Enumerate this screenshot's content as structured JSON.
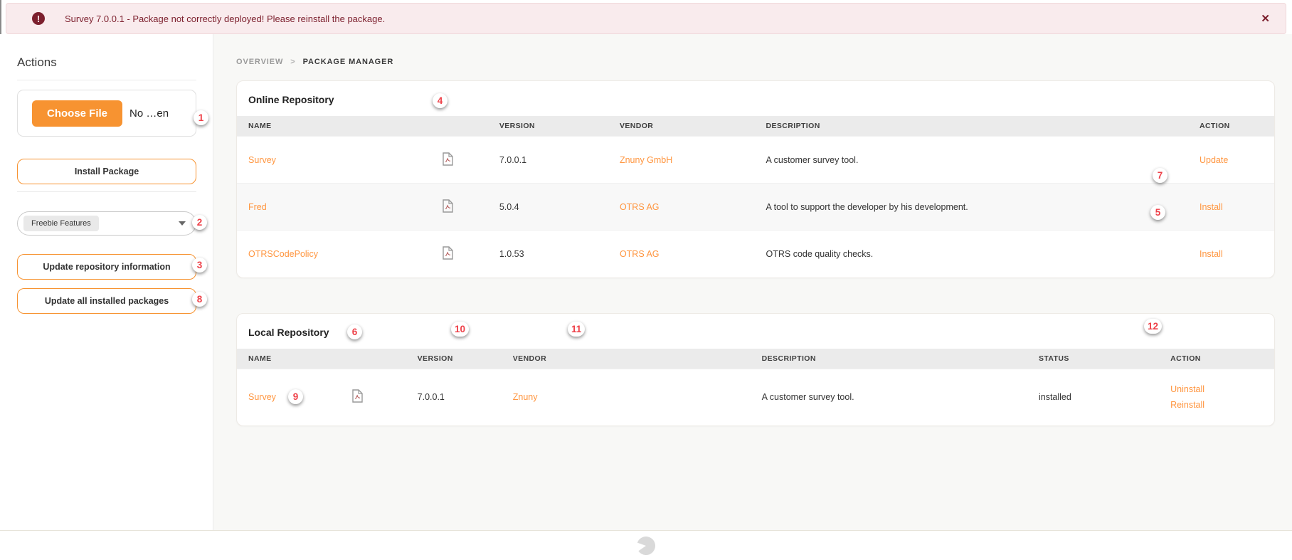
{
  "banner": {
    "icon_glyph": "!",
    "text": "Survey 7.0.0.1 - Package not correctly deployed! Please reinstall the package.",
    "close_glyph": "✕"
  },
  "sidebar": {
    "title": "Actions",
    "choose_file": "Choose File",
    "file_status": "No …en",
    "install": "Install Package",
    "select_value": "Freebie Features",
    "update_repo": "Update repository information",
    "update_all": "Update all installed packages"
  },
  "breadcrumb": {
    "overview": "OVERVIEW",
    "separator": ">",
    "current": "PACKAGE MANAGER"
  },
  "online": {
    "title": "Online Repository",
    "headers": {
      "name": "NAME",
      "version": "VERSION",
      "vendor": "VENDOR",
      "description": "DESCRIPTION",
      "action": "ACTION"
    },
    "rows": [
      {
        "name": "Survey",
        "version": "7.0.0.1",
        "vendor": "Znuny GmbH",
        "description": "A customer survey tool.",
        "action": "Update"
      },
      {
        "name": "Fred",
        "version": "5.0.4",
        "vendor": "OTRS AG",
        "description": "A tool to support the developer by his development.",
        "action": "Install"
      },
      {
        "name": "OTRSCodePolicy",
        "version": "1.0.53",
        "vendor": "OTRS AG",
        "description": "OTRS code quality checks.",
        "action": "Install"
      }
    ]
  },
  "local": {
    "title": "Local Repository",
    "headers": {
      "name": "NAME",
      "version": "VERSION",
      "vendor": "VENDOR",
      "description": "DESCRIPTION",
      "status": "STATUS",
      "action": "ACTION"
    },
    "rows": [
      {
        "name": "Survey",
        "version": "7.0.0.1",
        "vendor": "Znuny",
        "description": "A customer survey tool.",
        "status": "installed",
        "action_1": "Uninstall",
        "action_2": "Reinstall"
      }
    ]
  },
  "markers": {
    "m1": "1",
    "m2": "2",
    "m3": "3",
    "m4": "4",
    "m5": "5",
    "m6": "6",
    "m7": "7",
    "m8": "8",
    "m9": "9",
    "m10": "10",
    "m11": "11",
    "m12": "12"
  },
  "colors": {
    "accent_orange": "#f79331",
    "link_orange": "#ff9640",
    "error_text": "#7c1f2d",
    "error_bg": "#f9ebed",
    "badge_red": "#ee4048"
  }
}
